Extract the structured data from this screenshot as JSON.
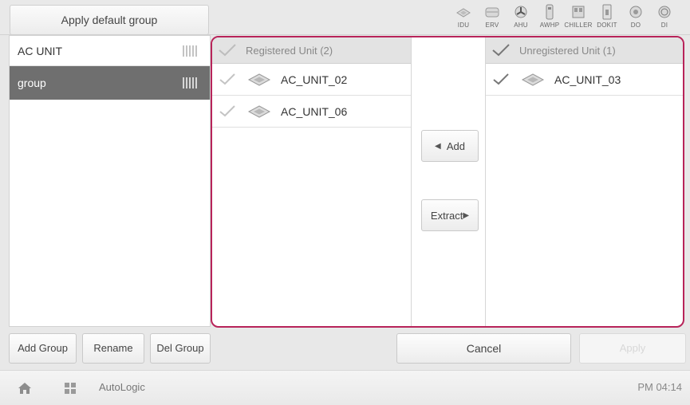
{
  "header": {
    "apply_default_label": "Apply default group",
    "type_icons": [
      {
        "name": "idu-icon",
        "label": "IDU"
      },
      {
        "name": "erv-icon",
        "label": "ERV"
      },
      {
        "name": "ahu-icon",
        "label": "AHU"
      },
      {
        "name": "awhp-icon",
        "label": "AWHP"
      },
      {
        "name": "chiller-icon",
        "label": "CHILLER"
      },
      {
        "name": "dokit-icon",
        "label": "DOKIT"
      },
      {
        "name": "do-icon",
        "label": "DO"
      },
      {
        "name": "di-icon",
        "label": "DI"
      }
    ]
  },
  "groups": [
    {
      "label": "AC UNIT",
      "selected": false
    },
    {
      "label": "group",
      "selected": true
    }
  ],
  "registered": {
    "header": "Registered Unit (2)",
    "units": [
      "AC_UNIT_02",
      "AC_UNIT_06"
    ]
  },
  "unregistered": {
    "header": "Unregistered Unit (1)",
    "units": [
      "AC_UNIT_03"
    ]
  },
  "transfer": {
    "add_label": "Add",
    "extract_label": "Extract"
  },
  "actions": {
    "add_group": "Add Group",
    "rename": "Rename",
    "del_group": "Del Group",
    "cancel": "Cancel",
    "apply": "Apply"
  },
  "status_bar": {
    "app_name": "AutoLogic",
    "time": "PM 04:14"
  },
  "colors": {
    "frame_border": "#b8245a",
    "selected_row": "#6f6f6f",
    "apply_disabled_text": "#d8d8d8"
  }
}
